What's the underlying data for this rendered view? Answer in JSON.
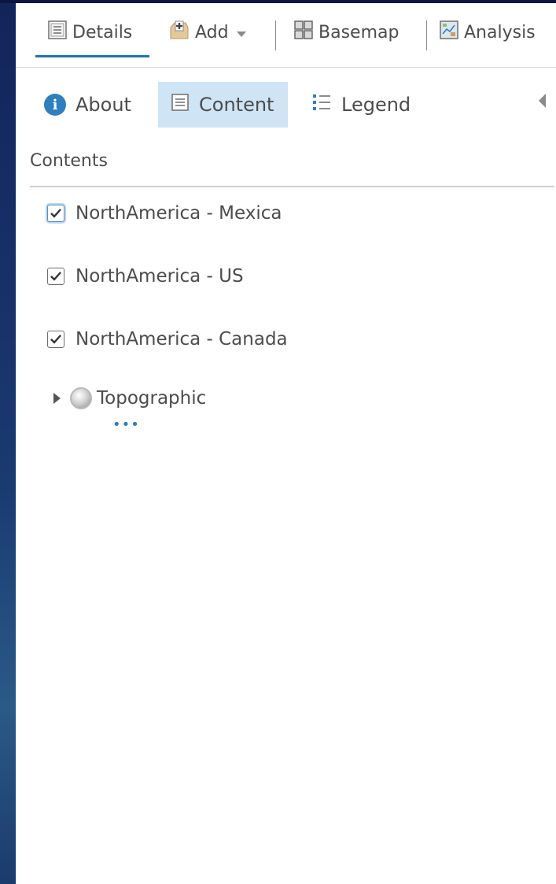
{
  "toolbar": {
    "details_label": "Details",
    "add_label": "Add",
    "basemap_label": "Basemap",
    "analysis_label": "Analysis",
    "active_tab": "Details"
  },
  "subtabs": {
    "about_label": "About",
    "content_label": "Content",
    "legend_label": "Legend",
    "active": "Content"
  },
  "contents": {
    "title": "Contents",
    "layers": [
      {
        "name": "NorthAmerica - Mexica",
        "checked": true
      },
      {
        "name": "NorthAmerica - US",
        "checked": true
      },
      {
        "name": "NorthAmerica - Canada",
        "checked": true
      }
    ],
    "basemap": {
      "name": "Topographic",
      "expanded": false
    }
  },
  "colors": {
    "accent": "#1e74b5",
    "active_tab_bg": "#cfe4f4",
    "text": "#4c4c4c",
    "page_bg": "#0f1d4a"
  }
}
